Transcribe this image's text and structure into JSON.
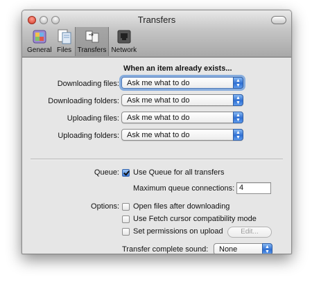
{
  "window": {
    "title": "Transfers"
  },
  "toolbar": {
    "tabs": [
      {
        "label": "General",
        "icon": "general-icon"
      },
      {
        "label": "Files",
        "icon": "files-icon"
      },
      {
        "label": "Transfers",
        "icon": "transfers-icon",
        "selected": true
      },
      {
        "label": "Network",
        "icon": "network-icon"
      }
    ]
  },
  "existing_item": {
    "heading": "When an item already exists...",
    "rows": [
      {
        "label": "Downloading files:",
        "value": "Ask me what to do"
      },
      {
        "label": "Downloading folders:",
        "value": "Ask me what to do"
      },
      {
        "label": "Uploading files:",
        "value": "Ask me what to do"
      },
      {
        "label": "Uploading folders:",
        "value": "Ask me what to do"
      }
    ]
  },
  "queue": {
    "label": "Queue:",
    "use_queue_label": "Use Queue for all transfers",
    "use_queue_checked": true,
    "max_connections_label": "Maximum queue connections:",
    "max_connections_value": "4"
  },
  "options": {
    "label": "Options:",
    "items": [
      {
        "label": "Open files after downloading",
        "checked": false
      },
      {
        "label": "Use Fetch cursor compatibility mode",
        "checked": false
      },
      {
        "label": "Set permissions on upload",
        "checked": false
      }
    ],
    "edit_button_label": "Edit...",
    "sound_label": "Transfer complete sound:",
    "sound_value": "None"
  },
  "colors": {
    "accent": "#3c7ad6",
    "close_button": "#d33a28"
  }
}
